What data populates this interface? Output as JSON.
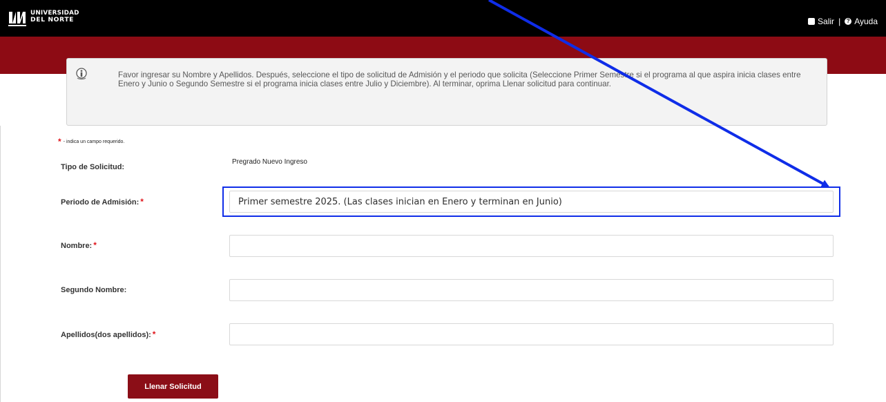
{
  "header": {
    "logo": {
      "mark": "UN",
      "line1": "UNIVERSIDAD",
      "line2": "DEL NORTE"
    },
    "links": {
      "logout": "Salir",
      "separator": "|",
      "help": "Ayuda"
    },
    "colors": {
      "top_bar": "#000000",
      "banner": "#8d0b14",
      "accent": "#8b0e17"
    }
  },
  "instructions": {
    "text": "Favor ingresar su Nombre y Apellidos. Después, seleccione el tipo de solicitud de Admisión y el periodo que solicita (Seleccione Primer Semestre si el programa al que aspira inicia clases entre Enero y Junio o Segundo Semestre si el programa inicia clases entre Julio y Diciembre). Al terminar, oprima Llenar solicitud para continuar."
  },
  "required_note": {
    "marker": "*",
    "text": "- indica un campo requerido."
  },
  "form": {
    "request_type": {
      "label": "Tipo de Solicitud:",
      "value": "Pregrado Nuevo Ingreso"
    },
    "admission_period": {
      "label": "Periodo de Admisión:",
      "required": "*",
      "selected": "Primer semestre 2025. (Las clases inician en Enero y terminan en Junio)"
    },
    "first_name": {
      "label": "Nombre:",
      "required": "*",
      "value": ""
    },
    "middle_name": {
      "label": "Segundo Nombre:",
      "value": ""
    },
    "last_names": {
      "label": "Apellidos(dos apellidos):",
      "required": "*",
      "value": ""
    },
    "submit_label": "Llenar Solicitud"
  },
  "annotation": {
    "color": "#0f2de8"
  }
}
